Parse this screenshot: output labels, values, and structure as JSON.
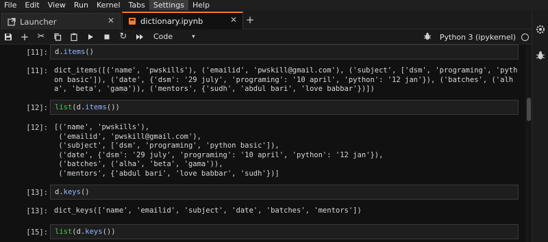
{
  "menu": {
    "items": [
      "File",
      "Edit",
      "View",
      "Run",
      "Kernel",
      "Tabs",
      "Settings",
      "Help"
    ],
    "active": "Settings"
  },
  "tabs": [
    {
      "label": "Launcher",
      "icon": "launcher-icon"
    },
    {
      "label": "dictionary.ipynb",
      "icon": "notebook-icon"
    }
  ],
  "toolbar": {
    "cell_type": "Code",
    "kernel_name": "Python 3 (ipykernel)"
  },
  "cells": [
    {
      "in_prompt": "[11]:",
      "input": {
        "obj": "d",
        "method": "items",
        "suffix": "()"
      },
      "out_prompt": "[11]:",
      "output": "dict_items([('name', 'pwskills'), ('emailid', 'pwskill@gmail.com'), ('subject', ['dsm', 'programing', 'python basic']), ('date', {'dsm': '29 july', 'programing': '10 april', 'python': '12 jan'}), ('batches', ('alha', 'beta', 'gama')), ('mentors', {'sudh', 'abdul bari', 'love babbar'})])"
    },
    {
      "in_prompt": "[12]:",
      "input": {
        "fn": "list",
        "obj": "d",
        "method": "items",
        "suffix": "())"
      },
      "out_prompt": "[12]:",
      "output": "[('name', 'pwskills'),\n ('emailid', 'pwskill@gmail.com'),\n ('subject', ['dsm', 'programing', 'python basic']),\n ('date', {'dsm': '29 july', 'programing': '10 april', 'python': '12 jan'}),\n ('batches', ('alha', 'beta', 'gama')),\n ('mentors', {'abdul bari', 'love babbar', 'sudh'})]"
    },
    {
      "in_prompt": "[13]:",
      "input": {
        "obj": "d",
        "method": "keys",
        "suffix": "()"
      },
      "out_prompt": "[13]:",
      "output": "dict_keys(['name', 'emailid', 'subject', 'date', 'batches', 'mentors'])"
    },
    {
      "in_prompt": "[15]:",
      "input": {
        "fn": "list",
        "obj": "d",
        "method": "keys",
        "suffix": "())"
      }
    }
  ]
}
